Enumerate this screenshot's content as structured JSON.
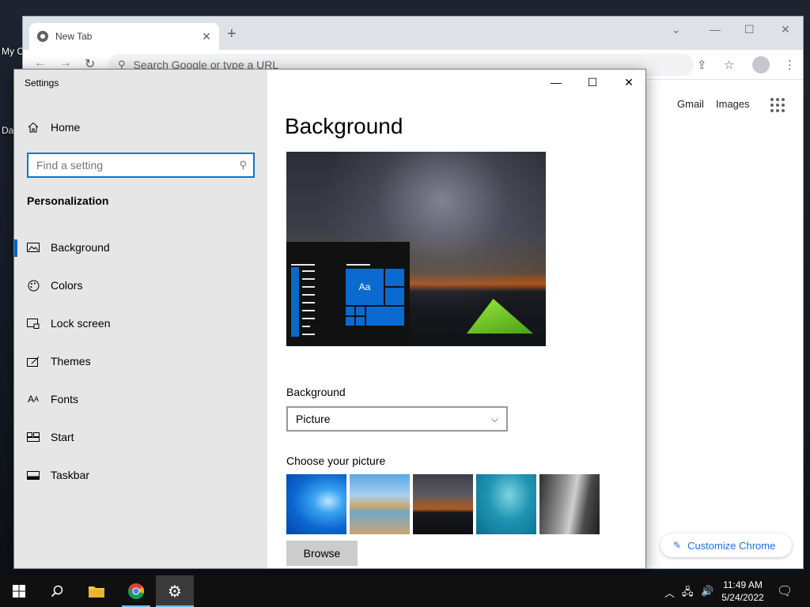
{
  "desktop": {
    "icon_labels": [
      "My C",
      "Da"
    ]
  },
  "chrome": {
    "tab_title": "New Tab",
    "tab_close": "✕",
    "new_tab": "+",
    "omnibox_placeholder": "Search Google or type a URL",
    "links": {
      "gmail": "Gmail",
      "images": "Images"
    },
    "customize_label": "Customize Chrome"
  },
  "settings": {
    "window_title": "Settings",
    "home_label": "Home",
    "search_placeholder": "Find a setting",
    "section_label": "Personalization",
    "nav_items": [
      {
        "label": "Background",
        "icon": "picture-icon",
        "active": true
      },
      {
        "label": "Colors",
        "icon": "palette-icon",
        "active": false
      },
      {
        "label": "Lock screen",
        "icon": "lock-screen-icon",
        "active": false
      },
      {
        "label": "Themes",
        "icon": "themes-icon",
        "active": false
      },
      {
        "label": "Fonts",
        "icon": "fonts-icon",
        "active": false
      },
      {
        "label": "Start",
        "icon": "start-icon",
        "active": false
      },
      {
        "label": "Taskbar",
        "icon": "taskbar-icon",
        "active": false
      }
    ],
    "page_title": "Background",
    "preview_tile_text": "Aa",
    "background_label": "Background",
    "background_value": "Picture",
    "choose_picture_label": "Choose your picture",
    "pictures": [
      "windows-blue",
      "beach-rocks",
      "night-tent",
      "underwater-swimmer",
      "rock-cliff"
    ],
    "browse_label": "Browse"
  },
  "taskbar": {
    "pinned": [
      "start-icon",
      "search-icon",
      "file-explorer-icon",
      "chrome-icon",
      "settings-icon"
    ],
    "time": "11:49 AM",
    "date": "5/24/2022"
  },
  "colors": {
    "accent": "#0078d7",
    "sidebar_bg": "#e6e6e6",
    "taskbar_bg": "#101010",
    "chrome_link": "#1a73e8"
  }
}
